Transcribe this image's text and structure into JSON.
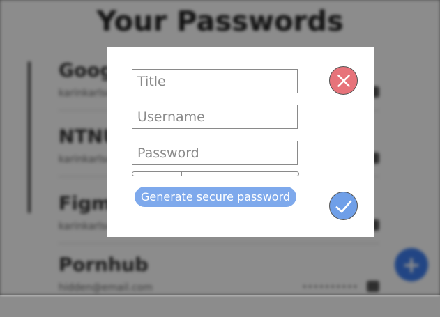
{
  "background": {
    "title": "Your Passwords",
    "entries": [
      {
        "name": "Google",
        "username": "karinkarlsen@gmail.com",
        "masked": "••••••••••"
      },
      {
        "name": "NTNU",
        "username": "karinkarlsen@gmail.com",
        "masked": "••••••••••"
      },
      {
        "name": "Figma",
        "username": "karinkarlsen@gmail.com",
        "masked": "••••••••••"
      },
      {
        "name": "Pornhub",
        "username": "hidden@email.com",
        "masked": "••••••••••"
      }
    ],
    "fab_label": "+"
  },
  "modal": {
    "title_placeholder": "Title",
    "username_placeholder": "Username",
    "password_placeholder": "Password",
    "generate_label": "Generate secure password",
    "close_icon": "close-icon",
    "confirm_icon": "checkmark-icon",
    "colors": {
      "close": "#e7737a",
      "confirm": "#6f9fe8",
      "generate": "#7ea9ec"
    }
  }
}
